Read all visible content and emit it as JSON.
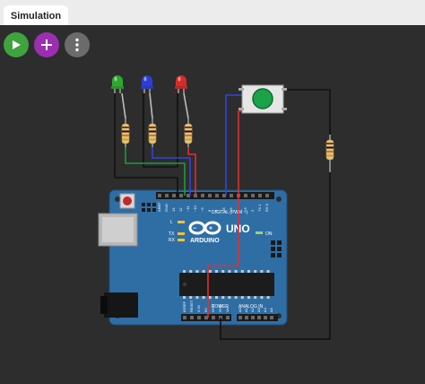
{
  "tabs": [
    {
      "label": "Simulation",
      "active": true
    }
  ],
  "toolbar": {
    "play_icon": "play-icon",
    "add_icon": "plus-icon",
    "more_icon": "more-vertical-icon"
  },
  "board": {
    "brand": "ARDUINO",
    "model": "UNO",
    "digital_label": "DIGITAL (PWM ~)",
    "analog_label": "ANALOG IN",
    "power_label": "POWER",
    "on_label": "ON",
    "tx_label": "TX",
    "rx_label": "RX",
    "l_label": "L",
    "top_pin_labels": [
      "AREF",
      "GND",
      "13",
      "12",
      "~11",
      "~10",
      "~9",
      "8",
      "7",
      "~6",
      "~5",
      "4",
      "~3",
      "2",
      "TX 1",
      "RX 0"
    ],
    "power_pin_labels": [
      "IOREF",
      "RESET",
      "3.3V",
      "5V",
      "GND",
      "GND",
      "Vin"
    ],
    "analog_pin_labels": [
      "A0",
      "A1",
      "A2",
      "A3",
      "A4",
      "A5"
    ]
  },
  "components": {
    "leds": [
      {
        "color": "green",
        "hex": "#2ea82e"
      },
      {
        "color": "blue",
        "hex": "#2b3fd6"
      },
      {
        "color": "red",
        "hex": "#d62b2b"
      }
    ],
    "pushbutton_color": "#1aa34a"
  },
  "wire_colors": {
    "black": "#111111",
    "green": "#1f9a3a",
    "blue": "#2f44e0",
    "red": "#e02f2f"
  }
}
